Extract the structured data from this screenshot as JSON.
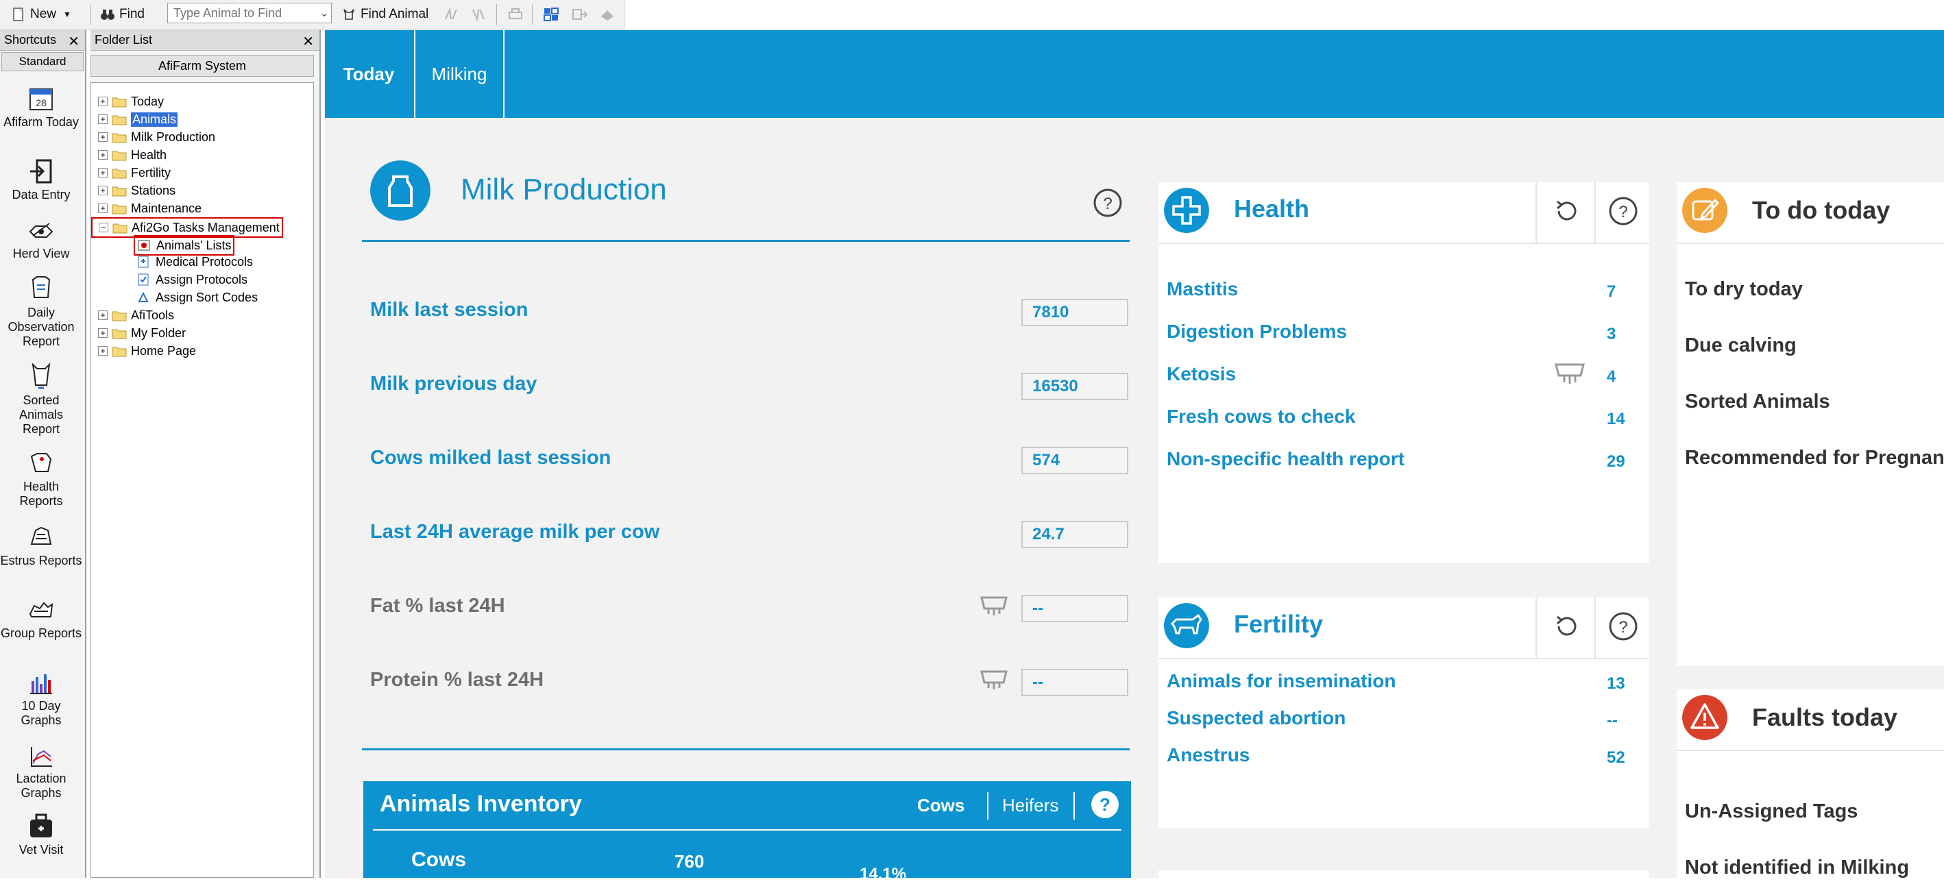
{
  "toolbar": {
    "new_label": "New",
    "find_label": "Find",
    "search_placeholder": "Type Animal to Find",
    "find_animal_label": "Find Animal"
  },
  "shortcuts": {
    "title": "Shortcuts",
    "group": "Standard",
    "items": [
      {
        "label": "Afifarm Today",
        "icon": "calendar-icon"
      },
      {
        "label": "Data Entry",
        "icon": "data-entry-icon"
      },
      {
        "label": "Herd View",
        "icon": "herd-view-icon"
      },
      {
        "label": "Daily Observation Report",
        "icon": "daily-observation-icon"
      },
      {
        "label": "Sorted Animals Report",
        "icon": "sorted-animals-icon"
      },
      {
        "label": "Health Reports",
        "icon": "health-reports-icon"
      },
      {
        "label": "Estrus Reports",
        "icon": "estrus-reports-icon"
      },
      {
        "label": "Group Reports",
        "icon": "group-reports-icon"
      },
      {
        "label": "10 Day Graphs",
        "icon": "bar-graph-icon"
      },
      {
        "label": "Lactation Graphs",
        "icon": "line-graph-icon"
      },
      {
        "label": "Vet Visit",
        "icon": "vet-bag-icon"
      }
    ]
  },
  "folder_list": {
    "title": "Folder List",
    "root": "AfiFarm System",
    "items": [
      {
        "label": "Today"
      },
      {
        "label": "Animals"
      },
      {
        "label": "Milk Production"
      },
      {
        "label": "Health"
      },
      {
        "label": "Fertility"
      },
      {
        "label": "Stations"
      },
      {
        "label": "Maintenance"
      },
      {
        "label": "Afi2Go Tasks Management"
      },
      {
        "label": "Animals' Lists"
      },
      {
        "label": "Medical Protocols"
      },
      {
        "label": "Assign Protocols"
      },
      {
        "label": "Assign Sort Codes"
      },
      {
        "label": "AfiTools"
      },
      {
        "label": "My Folder"
      },
      {
        "label": "Home Page"
      }
    ]
  },
  "tabs": [
    {
      "label": "Today"
    },
    {
      "label": "Milking"
    }
  ],
  "milk_production": {
    "title": "Milk Production",
    "metrics": [
      {
        "label": "Milk last session",
        "value": "7810"
      },
      {
        "label": "Milk previous day",
        "value": "16530"
      },
      {
        "label": "Cows milked last session",
        "value": "574"
      },
      {
        "label": "Last 24H average milk per cow",
        "value": "24.7"
      },
      {
        "label": "Fat % last 24H",
        "value": "--"
      },
      {
        "label": "Protein % last 24H",
        "value": "--"
      }
    ]
  },
  "inventory": {
    "title": "Animals Inventory",
    "tab_cows": "Cows",
    "tab_heifers": "Heifers",
    "row_label": "Cows",
    "row_value": "760",
    "row_percent": "14.1%"
  },
  "health": {
    "title": "Health",
    "rows": [
      {
        "label": "Mastitis",
        "value": "7"
      },
      {
        "label": "Digestion Problems",
        "value": "3"
      },
      {
        "label": "Ketosis",
        "value": "4"
      },
      {
        "label": "Fresh cows to check",
        "value": "14"
      },
      {
        "label": "Non-specific health report",
        "value": "29"
      }
    ]
  },
  "fertility": {
    "title": "Fertility",
    "rows": [
      {
        "label": "Animals for insemination",
        "value": "13"
      },
      {
        "label": "Suspected abortion",
        "value": "--"
      },
      {
        "label": "Anestrus",
        "value": "52"
      }
    ]
  },
  "todo": {
    "title": "To do today",
    "rows": [
      {
        "label": "To dry today"
      },
      {
        "label": "Due calving"
      },
      {
        "label": "Sorted Animals"
      },
      {
        "label": "Recommended for Pregnan"
      }
    ]
  },
  "faults": {
    "title": "Faults today",
    "rows": [
      {
        "label": "Un-Assigned Tags"
      },
      {
        "label": "Not identified in Milking"
      }
    ]
  },
  "colors": {
    "brand_blue": "#0d93cf",
    "text_blue": "#1590c8",
    "todo_orange": "#f2a33a",
    "fault_red": "#d8402a"
  }
}
